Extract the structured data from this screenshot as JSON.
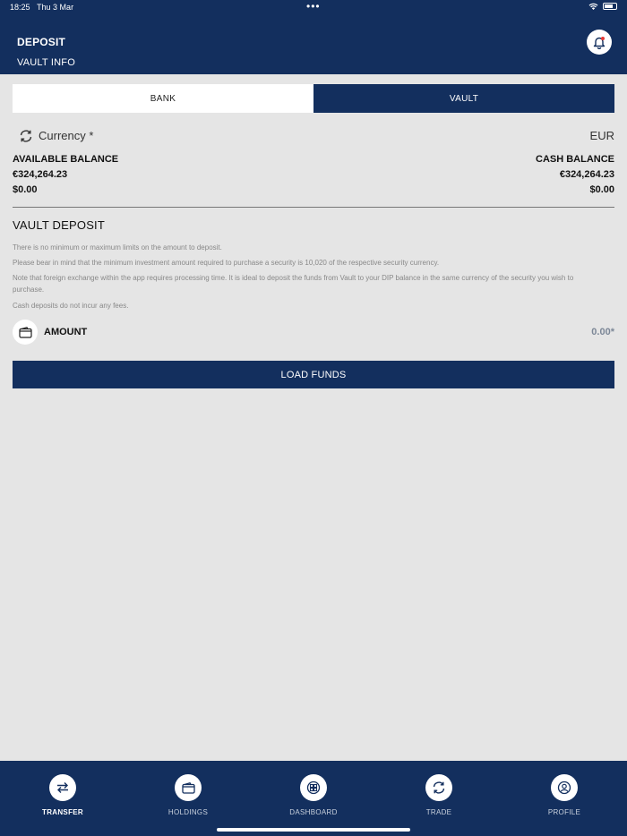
{
  "status": {
    "time": "18:25",
    "date": "Thu 3 Mar"
  },
  "header": {
    "title": "DEPOSIT",
    "subtitle": "VAULT INFO",
    "notification_icon": "bell-icon"
  },
  "tabs": [
    {
      "label": "BANK",
      "active": false
    },
    {
      "label": "VAULT",
      "active": true
    }
  ],
  "currency": {
    "label": "Currency *",
    "value": "EUR",
    "icon": "refresh-icon"
  },
  "balances": {
    "available_label": "AVAILABLE BALANCE",
    "available_values": [
      "€324,264.23",
      "$0.00"
    ],
    "cash_label": "CASH BALANCE",
    "cash_values": [
      "€324,264.23",
      "$0.00"
    ]
  },
  "vault_deposit": {
    "title": "VAULT DEPOSIT",
    "notes": [
      "There is no minimum or maximum limits on the amount to deposit.",
      "Please bear in mind that the minimum investment amount required to purchase a security is 10,020 of the respective security currency.",
      "Note that foreign exchange within the app requires processing time. It is ideal to deposit the funds from Vault to your DIP balance in the same currency of the security you wish to purchase.",
      "Cash deposits do not incur any fees."
    ]
  },
  "amount": {
    "label": "AMOUNT",
    "value": "0.00*",
    "icon": "wallet-icon"
  },
  "load_button": {
    "label": "LOAD FUNDS"
  },
  "nav": [
    {
      "label": "TRANSFER",
      "icon": "transfer-icon",
      "active": true
    },
    {
      "label": "HOLDINGS",
      "icon": "wallet-icon",
      "active": false
    },
    {
      "label": "DASHBOARD",
      "icon": "dashboard-icon",
      "active": false
    },
    {
      "label": "TRADE",
      "icon": "refresh-icon",
      "active": false
    },
    {
      "label": "PROFILE",
      "icon": "profile-icon",
      "active": false
    }
  ],
  "colors": {
    "primary": "#132f5e",
    "background": "#e5e5e5",
    "muted_text": "#888888"
  }
}
